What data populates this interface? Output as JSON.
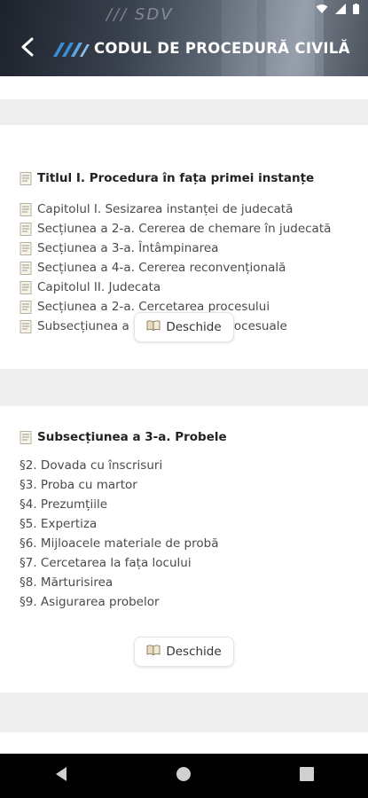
{
  "header": {
    "status_logo": "/// SDV",
    "title": "CODUL DE PROCEDURĂ CIVILĂ"
  },
  "cards": [
    {
      "title": "Titlul I. Procedura în fața primei instanțe",
      "items": [
        "Capitolul I. Sesizarea instanței de judecată",
        "Secțiunea a 2-a. Cererea de chemare în judecată",
        "Secțiunea a 3-a. Întâmpinarea",
        "Secțiunea a 4-a. Cererea reconvențională",
        "Capitolul II. Judecata",
        "Secțiunea a 2-a. Cercetarea procesului",
        "Subsecțiunea a 2-a. Excepțiile procesuale"
      ],
      "button_label": "Deschide"
    },
    {
      "title": "Subsecțiunea a 3-a. Probele",
      "items": [
        "§2. Dovada cu înscrisuri",
        "§3. Proba cu martor",
        "§4. Prezumțiile",
        "§5. Expertiza",
        "§6. Mijloacele materiale de probă",
        "§7. Cercetarea la fața locului",
        "§8. Mărturisirea",
        "§9. Asigurarea probelor"
      ],
      "button_label": "Deschide"
    }
  ],
  "icons": {
    "status": [
      "wifi-icon",
      "signal-icon",
      "battery-icon"
    ],
    "header": [
      "back-arrow-icon",
      "app-logo-icon"
    ],
    "items": "document-icon",
    "button": "open-book-icon",
    "nav": [
      "nav-back-icon",
      "nav-home-icon",
      "nav-recents-icon"
    ]
  },
  "colors": {
    "header_dark": "#1d222b",
    "logo_blue": "#3b8fd6",
    "text": "#4a4a4a",
    "page_bg": "#efefef"
  }
}
